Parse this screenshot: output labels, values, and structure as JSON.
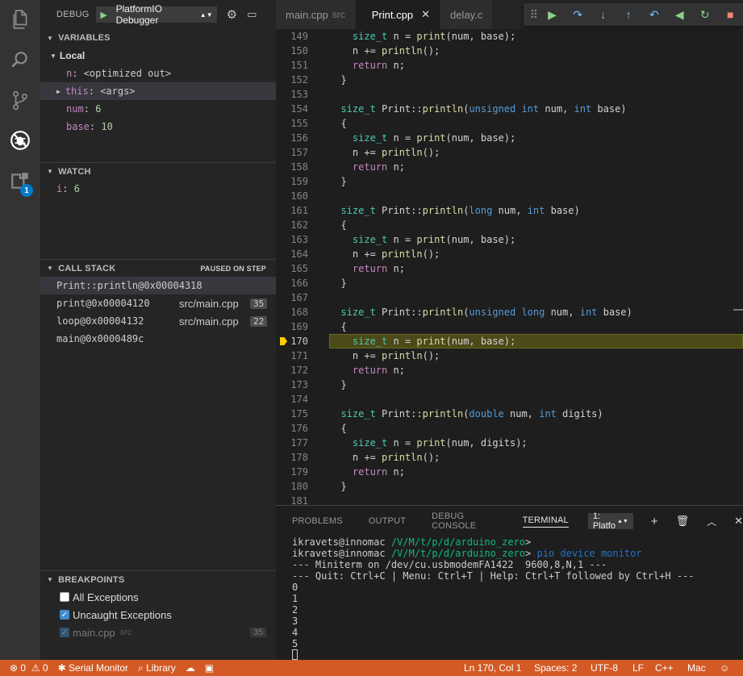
{
  "debug": {
    "label": "DEBUG",
    "config": "PlatformIO Debugger"
  },
  "tabs": [
    {
      "label": "main.cpp",
      "desc": "src"
    },
    {
      "label": "Print.cpp",
      "desc": ""
    },
    {
      "label": "delay.c",
      "desc": ""
    }
  ],
  "sections": {
    "variables": "VARIABLES",
    "watch": "WATCH",
    "callstack": "CALL STACK",
    "callstack_state": "PAUSED ON STEP",
    "breakpoints": "BREAKPOINTS"
  },
  "variables": {
    "scope": "Local",
    "items": [
      {
        "name": "n",
        "value": "<optimized out>"
      },
      {
        "name": "this",
        "value": "<args>"
      },
      {
        "name": "num",
        "value": "6"
      },
      {
        "name": "base",
        "value": "10"
      }
    ]
  },
  "watch": [
    {
      "name": "i",
      "value": "6"
    }
  ],
  "callstack": [
    {
      "fn": "Print::println@0x00004318",
      "file": "",
      "line": ""
    },
    {
      "fn": "print@0x00004120",
      "file": "src/main.cpp",
      "line": "35"
    },
    {
      "fn": "loop@0x00004132",
      "file": "src/main.cpp",
      "line": "22"
    },
    {
      "fn": "main@0x0000489c",
      "file": "",
      "line": ""
    }
  ],
  "breakpoints": [
    {
      "label": "All Exceptions",
      "checked": false
    },
    {
      "label": "Uncaught Exceptions",
      "checked": true
    },
    {
      "label": "main.cpp",
      "desc": "src",
      "line": "35",
      "checked": true
    }
  ],
  "editor": {
    "current_line": 170,
    "lines": [
      {
        "n": "149",
        "code": "    size_t n = print(num, base);"
      },
      {
        "n": "150",
        "code": "    n += println();"
      },
      {
        "n": "151",
        "code": "    return n;"
      },
      {
        "n": "152",
        "code": "  }"
      },
      {
        "n": "153",
        "code": ""
      },
      {
        "n": "154",
        "code": "  size_t Print::println(unsigned int num, int base)"
      },
      {
        "n": "155",
        "code": "  {"
      },
      {
        "n": "156",
        "code": "    size_t n = print(num, base);"
      },
      {
        "n": "157",
        "code": "    n += println();"
      },
      {
        "n": "158",
        "code": "    return n;"
      },
      {
        "n": "159",
        "code": "  }"
      },
      {
        "n": "160",
        "code": ""
      },
      {
        "n": "161",
        "code": "  size_t Print::println(long num, int base)"
      },
      {
        "n": "162",
        "code": "  {"
      },
      {
        "n": "163",
        "code": "    size_t n = print(num, base);"
      },
      {
        "n": "164",
        "code": "    n += println();"
      },
      {
        "n": "165",
        "code": "    return n;"
      },
      {
        "n": "166",
        "code": "  }"
      },
      {
        "n": "167",
        "code": ""
      },
      {
        "n": "168",
        "code": "  size_t Print::println(unsigned long num, int base)"
      },
      {
        "n": "169",
        "code": "  {"
      },
      {
        "n": "170",
        "code": "    size_t n = print(num, base);"
      },
      {
        "n": "171",
        "code": "    n += println();"
      },
      {
        "n": "172",
        "code": "    return n;"
      },
      {
        "n": "173",
        "code": "  }"
      },
      {
        "n": "174",
        "code": ""
      },
      {
        "n": "175",
        "code": "  size_t Print::println(double num, int digits)"
      },
      {
        "n": "176",
        "code": "  {"
      },
      {
        "n": "177",
        "code": "    size_t n = print(num, digits);"
      },
      {
        "n": "178",
        "code": "    n += println();"
      },
      {
        "n": "179",
        "code": "    return n;"
      },
      {
        "n": "180",
        "code": "  }"
      },
      {
        "n": "181",
        "code": ""
      }
    ]
  },
  "panel": {
    "tabs": [
      "PROBLEMS",
      "OUTPUT",
      "DEBUG CONSOLE",
      "TERMINAL"
    ],
    "terminal_select": "1: Platfo",
    "prompt_user": "ikravets@innomac",
    "prompt_path": "/V/M/t/p/d/arduino_zero",
    "prompt_end": ">",
    "command": "pio device monitor",
    "output": [
      "--- Miniterm on /dev/cu.usbmodemFA1422  9600,8,N,1 ---",
      "--- Quit: Ctrl+C | Menu: Ctrl+T | Help: Ctrl+T followed by Ctrl+H ---",
      "0",
      "1",
      "2",
      "3",
      "4",
      "5"
    ]
  },
  "status": {
    "errors": "0",
    "warnings": "0",
    "serial": "Serial Monitor",
    "library": "Library",
    "position": "Ln 170, Col 1",
    "spaces": "Spaces: 2",
    "encoding": "UTF-8",
    "eol": "LF",
    "language": "C++",
    "platform": "Mac"
  },
  "colors": {
    "statusbar": "#d35a25",
    "activity": "#333333",
    "sidebar": "#252526",
    "editor": "#1e1e1e",
    "current_line": "#4b4a18",
    "breakpoint_arrow": "#ffcc00"
  }
}
